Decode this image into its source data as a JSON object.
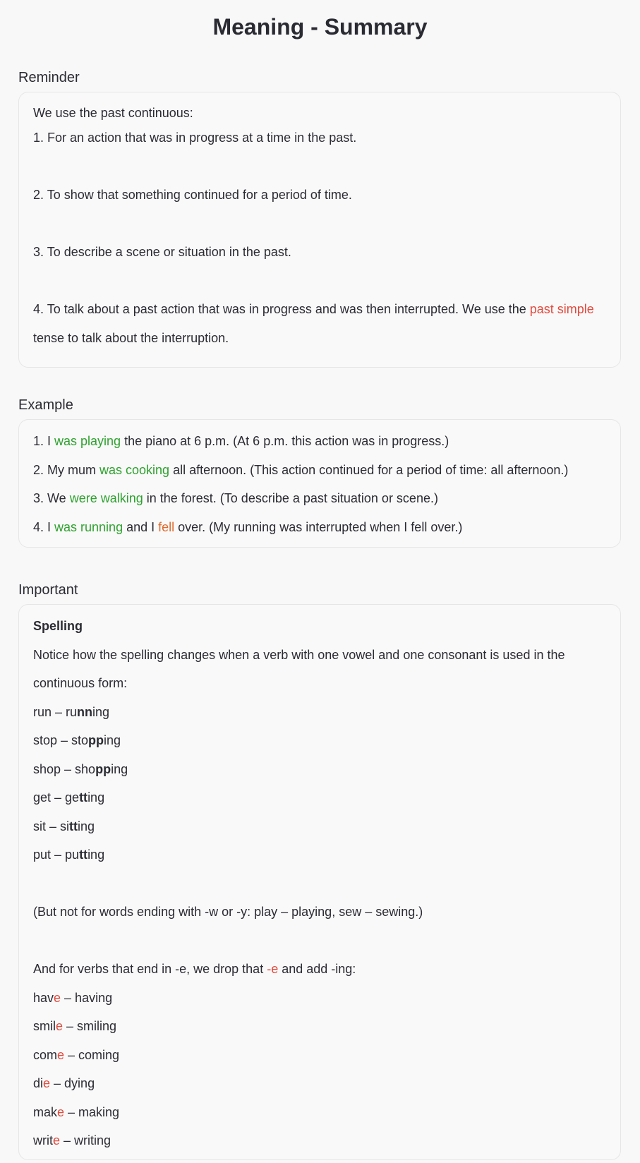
{
  "page": {
    "title": "Meaning - Summary"
  },
  "reminder": {
    "heading": "Reminder",
    "intro": "We use the past continuous:",
    "item1": "1. For an action that was in progress at a time in the past.",
    "item2": "2. To show that something continued for a period of time.",
    "item3": "3. To describe a scene or situation in the past.",
    "item4_pre": "4. To talk about a past action that was in progress and was then interrupted. We use the ",
    "item4_highlight": "past simple",
    "item4_post": " tense to talk about the interruption."
  },
  "example": {
    "heading": "Example",
    "items": [
      {
        "pre": "1. I ",
        "verb": "was playing",
        "post": " the piano at 6 p.m. (At 6 p.m. this action was in progress.)"
      },
      {
        "pre": "2. My mum ",
        "verb": "was cooking",
        "post": " all afternoon. (This action continued for a period of time: all afternoon.)"
      },
      {
        "pre": "3. We ",
        "verb": "were walking",
        "post": " in the forest. (To describe a past situation or scene.)"
      },
      {
        "pre": "4. I ",
        "verb": "was running",
        "mid": " and I ",
        "verb2": "fell",
        "post": " over. (My running was interrupted when I fell over.)"
      }
    ]
  },
  "important": {
    "heading": "Important",
    "subheading": "Spelling",
    "intro": "Notice how the spelling changes when a verb with one vowel and one consonant is used in the continuous form:",
    "doubling": [
      {
        "pre": "run – ru",
        "bold": "nn",
        "post": "ing"
      },
      {
        "pre": "stop – sto",
        "bold": "pp",
        "post": "ing"
      },
      {
        "pre": "shop – sho",
        "bold": "pp",
        "post": "ing"
      },
      {
        "pre": "get – ge",
        "bold": "tt",
        "post": "ing"
      },
      {
        "pre": "sit – si",
        "bold": "tt",
        "post": "ing"
      },
      {
        "pre": "put – pu",
        "bold": "tt",
        "post": "ing"
      }
    ],
    "exception": "(But not for words ending with -w or -y: play – playing, sew – sewing.)",
    "drop_pre": "And for verbs that end in -e, we drop that ",
    "drop_highlight": "-e",
    "drop_post": " and add -ing:",
    "drop_e": [
      {
        "stem": "hav",
        "e": "e",
        "post": " – having"
      },
      {
        "stem": "smil",
        "e": "e",
        "post": " – smiling"
      },
      {
        "stem": "com",
        "e": "e",
        "post": " – coming"
      },
      {
        "stem": "di",
        "e": "e",
        "post": " – dying"
      },
      {
        "stem": "mak",
        "e": "e",
        "post": " – making"
      },
      {
        "stem": "writ",
        "e": "e",
        "post": " – writing"
      }
    ]
  },
  "colors": {
    "verb_green": "#2ea12e",
    "highlight_red": "#e14a3d",
    "interrupt_orange": "#e0692c"
  }
}
